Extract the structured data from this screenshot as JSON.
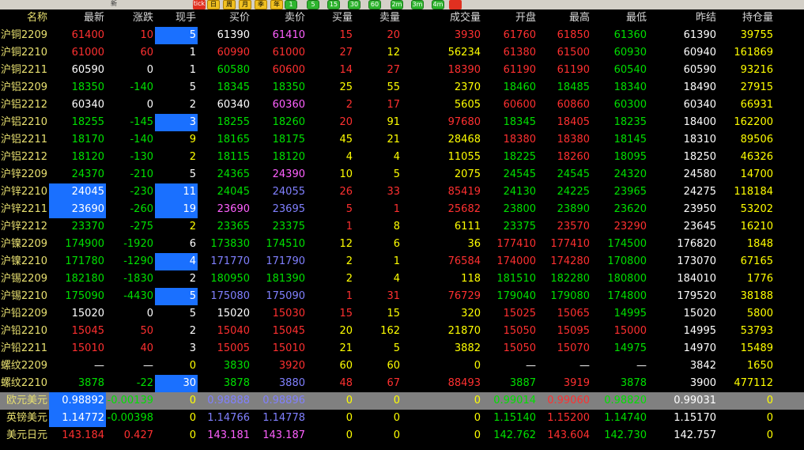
{
  "toolbar": {
    "icons": [
      {
        "name": "folder-open-icon",
        "label": "",
        "style": "plain"
      },
      {
        "name": "search-icon",
        "label": "",
        "style": "plain"
      },
      {
        "name": "key-icon",
        "label": "",
        "style": "plain"
      },
      {
        "name": "pencil-icon",
        "label": "",
        "style": "plain"
      },
      {
        "name": "layers-icon",
        "label": "",
        "style": "plain"
      },
      {
        "name": "pin-icon",
        "label": "",
        "style": "plain"
      },
      {
        "name": "new-icon",
        "label": "新",
        "style": "plain"
      },
      {
        "name": "list-icon",
        "label": "",
        "style": "plain"
      },
      {
        "name": "bar-chart-icon",
        "label": "",
        "style": "plain"
      },
      {
        "name": "tick-icon",
        "label": "tick",
        "style": "red"
      },
      {
        "name": "day-icon",
        "label": "日",
        "style": "yellow"
      },
      {
        "name": "week-icon",
        "label": "周",
        "style": "yellow"
      },
      {
        "name": "month-icon",
        "label": "月",
        "style": "yellow"
      },
      {
        "name": "season-icon",
        "label": "季",
        "style": "yellow"
      },
      {
        "name": "year-icon",
        "label": "年",
        "style": "yellow"
      },
      {
        "name": "period-1-icon",
        "label": "1",
        "style": "green"
      },
      {
        "name": "period-5-icon",
        "label": "5",
        "style": "green"
      },
      {
        "name": "period-15-icon",
        "label": "15",
        "style": "green"
      },
      {
        "name": "period-30-icon",
        "label": "30",
        "style": "green"
      },
      {
        "name": "period-60-icon",
        "label": "60",
        "style": "green"
      },
      {
        "name": "period-2m-icon",
        "label": "2m",
        "style": "green"
      },
      {
        "name": "period-3m-icon",
        "label": "3m",
        "style": "green"
      },
      {
        "name": "period-4m-icon",
        "label": "4m",
        "style": "green"
      },
      {
        "name": "calendar-icon",
        "label": "",
        "style": "red"
      }
    ]
  },
  "colors": {
    "up": "#ff3030",
    "down": "#00e000",
    "flat": "#ffffff",
    "name": "#e8e070",
    "blue": "#8080ff",
    "magenta": "#ff60ff",
    "yellow": "#ffff00",
    "header": "#d8d8d8"
  },
  "headers": [
    "名称",
    "最新",
    "涨跌",
    "现手",
    "买价",
    "卖价",
    "买量",
    "卖量",
    "成交量",
    "开盘",
    "最高",
    "最低",
    "昨结",
    "持仓量"
  ],
  "rows": [
    {
      "cells": [
        "沪铜2209",
        "61400",
        "10",
        "5",
        "61390",
        "61410",
        "15",
        "20",
        "3930",
        "61760",
        "61850",
        "61360",
        "61390",
        "39755"
      ],
      "colors": [
        "name",
        "up",
        "up",
        "flat",
        "flat",
        "magenta",
        "up",
        "up",
        "up",
        "up",
        "up",
        "down",
        "flat",
        "yellow"
      ],
      "hl": [
        3
      ]
    },
    {
      "cells": [
        "沪铜2210",
        "61000",
        "60",
        "1",
        "60990",
        "61000",
        "27",
        "12",
        "56234",
        "61380",
        "61500",
        "60930",
        "60940",
        "161869"
      ],
      "colors": [
        "name",
        "up",
        "up",
        "flat",
        "up",
        "up",
        "up",
        "yellow",
        "yellow",
        "up",
        "up",
        "down",
        "flat",
        "yellow"
      ],
      "hl": []
    },
    {
      "cells": [
        "沪铜2211",
        "60590",
        "0",
        "1",
        "60580",
        "60600",
        "14",
        "27",
        "18390",
        "61190",
        "61190",
        "60540",
        "60590",
        "93216"
      ],
      "colors": [
        "name",
        "flat",
        "flat",
        "flat",
        "down",
        "up",
        "up",
        "up",
        "up",
        "up",
        "up",
        "down",
        "flat",
        "yellow"
      ],
      "hl": []
    },
    {
      "cells": [
        "沪铝2209",
        "18350",
        "-140",
        "5",
        "18345",
        "18350",
        "25",
        "55",
        "2370",
        "18460",
        "18485",
        "18340",
        "18490",
        "27915"
      ],
      "colors": [
        "name",
        "down",
        "down",
        "flat",
        "down",
        "down",
        "yellow",
        "yellow",
        "yellow",
        "down",
        "down",
        "down",
        "flat",
        "yellow"
      ],
      "hl": []
    },
    {
      "cells": [
        "沪铝2212",
        "60340",
        "0",
        "2",
        "60340",
        "60360",
        "2",
        "17",
        "5605",
        "60600",
        "60860",
        "60300",
        "60340",
        "66931"
      ],
      "colors": [
        "name",
        "flat",
        "flat",
        "flat",
        "flat",
        "magenta",
        "up",
        "up",
        "yellow",
        "up",
        "up",
        "down",
        "flat",
        "yellow"
      ],
      "hl": []
    },
    {
      "cells": [
        "沪铝2210",
        "18255",
        "-145",
        "3",
        "18255",
        "18260",
        "20",
        "91",
        "97680",
        "18345",
        "18405",
        "18235",
        "18400",
        "162200"
      ],
      "colors": [
        "name",
        "down",
        "down",
        "flat",
        "down",
        "down",
        "up",
        "yellow",
        "up",
        "down",
        "up",
        "down",
        "flat",
        "yellow"
      ],
      "hl": [
        3
      ]
    },
    {
      "cells": [
        "沪铝2211",
        "18170",
        "-140",
        "9",
        "18165",
        "18175",
        "45",
        "21",
        "28468",
        "18380",
        "18380",
        "18145",
        "18310",
        "89506"
      ],
      "colors": [
        "name",
        "down",
        "down",
        "yellow",
        "down",
        "down",
        "yellow",
        "yellow",
        "yellow",
        "up",
        "up",
        "down",
        "flat",
        "yellow"
      ],
      "hl": []
    },
    {
      "cells": [
        "沪铝2212",
        "18120",
        "-130",
        "2",
        "18115",
        "18120",
        "4",
        "4",
        "11055",
        "18225",
        "18260",
        "18095",
        "18250",
        "46326"
      ],
      "colors": [
        "name",
        "down",
        "down",
        "yellow",
        "down",
        "down",
        "yellow",
        "yellow",
        "yellow",
        "down",
        "up",
        "down",
        "flat",
        "yellow"
      ],
      "hl": []
    },
    {
      "cells": [
        "沪锌2209",
        "24370",
        "-210",
        "5",
        "24365",
        "24390",
        "10",
        "5",
        "2075",
        "24545",
        "24545",
        "24320",
        "24580",
        "14700"
      ],
      "colors": [
        "name",
        "down",
        "down",
        "flat",
        "down",
        "magenta",
        "yellow",
        "yellow",
        "yellow",
        "down",
        "down",
        "down",
        "flat",
        "yellow"
      ],
      "hl": []
    },
    {
      "cells": [
        "沪锌2210",
        "24045",
        "-230",
        "11",
        "24045",
        "24055",
        "26",
        "33",
        "85419",
        "24130",
        "24225",
        "23965",
        "24275",
        "118184"
      ],
      "colors": [
        "name",
        "flat",
        "down",
        "flat",
        "down",
        "blue",
        "up",
        "up",
        "up",
        "down",
        "down",
        "down",
        "flat",
        "yellow"
      ],
      "hl": [
        1,
        3
      ]
    },
    {
      "cells": [
        "沪锌2211",
        "23690",
        "-260",
        "19",
        "23690",
        "23695",
        "5",
        "1",
        "25682",
        "23800",
        "23890",
        "23620",
        "23950",
        "53202"
      ],
      "colors": [
        "name",
        "flat",
        "down",
        "flat",
        "magenta",
        "blue",
        "up",
        "up",
        "up",
        "down",
        "down",
        "down",
        "flat",
        "yellow"
      ],
      "hl": [
        1,
        3
      ]
    },
    {
      "cells": [
        "沪锌2212",
        "23370",
        "-275",
        "2",
        "23365",
        "23375",
        "1",
        "8",
        "6111",
        "23375",
        "23570",
        "23290",
        "23645",
        "16210"
      ],
      "colors": [
        "name",
        "down",
        "down",
        "yellow",
        "down",
        "down",
        "up",
        "yellow",
        "yellow",
        "down",
        "up",
        "up",
        "flat",
        "yellow"
      ],
      "hl": []
    },
    {
      "cells": [
        "沪镍2209",
        "174900",
        "-1920",
        "6",
        "173830",
        "174510",
        "12",
        "6",
        "36",
        "177410",
        "177410",
        "174500",
        "176820",
        "1848"
      ],
      "colors": [
        "name",
        "down",
        "down",
        "flat",
        "down",
        "down",
        "yellow",
        "yellow",
        "yellow",
        "up",
        "up",
        "down",
        "flat",
        "yellow"
      ],
      "hl": []
    },
    {
      "cells": [
        "沪镍2210",
        "171780",
        "-1290",
        "4",
        "171770",
        "171790",
        "2",
        "1",
        "76584",
        "174000",
        "174280",
        "170800",
        "173070",
        "67165"
      ],
      "colors": [
        "name",
        "down",
        "down",
        "flat",
        "blue",
        "blue",
        "yellow",
        "yellow",
        "up",
        "up",
        "up",
        "down",
        "flat",
        "yellow"
      ],
      "hl": [
        3
      ]
    },
    {
      "cells": [
        "沪锡2209",
        "182180",
        "-1830",
        "2",
        "180950",
        "181390",
        "2",
        "4",
        "118",
        "181510",
        "182280",
        "180800",
        "184010",
        "1776"
      ],
      "colors": [
        "name",
        "down",
        "down",
        "flat",
        "down",
        "down",
        "yellow",
        "yellow",
        "yellow",
        "down",
        "down",
        "down",
        "flat",
        "yellow"
      ],
      "hl": []
    },
    {
      "cells": [
        "沪锡2210",
        "175090",
        "-4430",
        "5",
        "175080",
        "175090",
        "1",
        "31",
        "76729",
        "179040",
        "179080",
        "174800",
        "179520",
        "38188"
      ],
      "colors": [
        "name",
        "down",
        "down",
        "flat",
        "blue",
        "blue",
        "up",
        "up",
        "up",
        "down",
        "down",
        "down",
        "flat",
        "yellow"
      ],
      "hl": [
        3
      ]
    },
    {
      "cells": [
        "沪铅2209",
        "15020",
        "0",
        "5",
        "15020",
        "15030",
        "15",
        "15",
        "320",
        "15025",
        "15065",
        "14995",
        "15020",
        "5800"
      ],
      "colors": [
        "name",
        "flat",
        "flat",
        "flat",
        "flat",
        "up",
        "up",
        "yellow",
        "yellow",
        "up",
        "up",
        "down",
        "flat",
        "yellow"
      ],
      "hl": []
    },
    {
      "cells": [
        "沪铅2210",
        "15045",
        "50",
        "2",
        "15040",
        "15045",
        "20",
        "162",
        "21870",
        "15050",
        "15095",
        "15000",
        "14995",
        "53793"
      ],
      "colors": [
        "name",
        "up",
        "up",
        "flat",
        "up",
        "up",
        "yellow",
        "yellow",
        "yellow",
        "up",
        "up",
        "up",
        "flat",
        "yellow"
      ],
      "hl": []
    },
    {
      "cells": [
        "沪铅2211",
        "15010",
        "40",
        "3",
        "15005",
        "15010",
        "21",
        "5",
        "3882",
        "15050",
        "15070",
        "14975",
        "14970",
        "15489"
      ],
      "colors": [
        "name",
        "up",
        "up",
        "flat",
        "up",
        "up",
        "yellow",
        "yellow",
        "yellow",
        "up",
        "up",
        "down",
        "flat",
        "yellow"
      ],
      "hl": []
    },
    {
      "cells": [
        "螺纹2209",
        "—",
        "—",
        "0",
        "3830",
        "3920",
        "60",
        "60",
        "0",
        "—",
        "—",
        "—",
        "3842",
        "1650"
      ],
      "colors": [
        "name",
        "flat",
        "flat",
        "yellow",
        "down",
        "up",
        "yellow",
        "yellow",
        "yellow",
        "flat",
        "flat",
        "flat",
        "flat",
        "yellow"
      ],
      "hl": []
    },
    {
      "cells": [
        "螺纹2210",
        "3878",
        "-22",
        "30",
        "3878",
        "3880",
        "48",
        "67",
        "88493",
        "3887",
        "3919",
        "3878",
        "3900",
        "477112"
      ],
      "colors": [
        "name",
        "down",
        "down",
        "flat",
        "down",
        "blue",
        "up",
        "up",
        "up",
        "down",
        "up",
        "down",
        "flat",
        "yellow"
      ],
      "hl": [
        3
      ]
    },
    {
      "cells": [
        "欧元美元",
        "0.98892",
        "-0.00139",
        "0",
        "0.98888",
        "0.98896",
        "0",
        "0",
        "0",
        "0.99014",
        "0.99060",
        "0.98820",
        "0.99031",
        "0"
      ],
      "colors": [
        "name",
        "flat",
        "down",
        "yellow",
        "blue",
        "blue",
        "yellow",
        "yellow",
        "yellow",
        "down",
        "up",
        "down",
        "flat",
        "yellow"
      ],
      "hl": [
        1
      ],
      "sel": true
    },
    {
      "cells": [
        "英镑美元",
        "1.14772",
        "-0.00398",
        "0",
        "1.14766",
        "1.14778",
        "0",
        "0",
        "0",
        "1.15140",
        "1.15200",
        "1.14740",
        "1.15170",
        "0"
      ],
      "colors": [
        "name",
        "flat",
        "down",
        "yellow",
        "blue",
        "blue",
        "yellow",
        "yellow",
        "yellow",
        "down",
        "up",
        "down",
        "flat",
        "yellow"
      ],
      "hl": [
        1
      ]
    },
    {
      "cells": [
        "美元日元",
        "143.184",
        "0.427",
        "0",
        "143.181",
        "143.187",
        "0",
        "0",
        "0",
        "142.762",
        "143.604",
        "142.730",
        "142.757",
        "0"
      ],
      "colors": [
        "name",
        "up",
        "up",
        "yellow",
        "magenta",
        "magenta",
        "yellow",
        "yellow",
        "yellow",
        "down",
        "up",
        "down",
        "flat",
        "yellow"
      ],
      "hl": []
    }
  ]
}
